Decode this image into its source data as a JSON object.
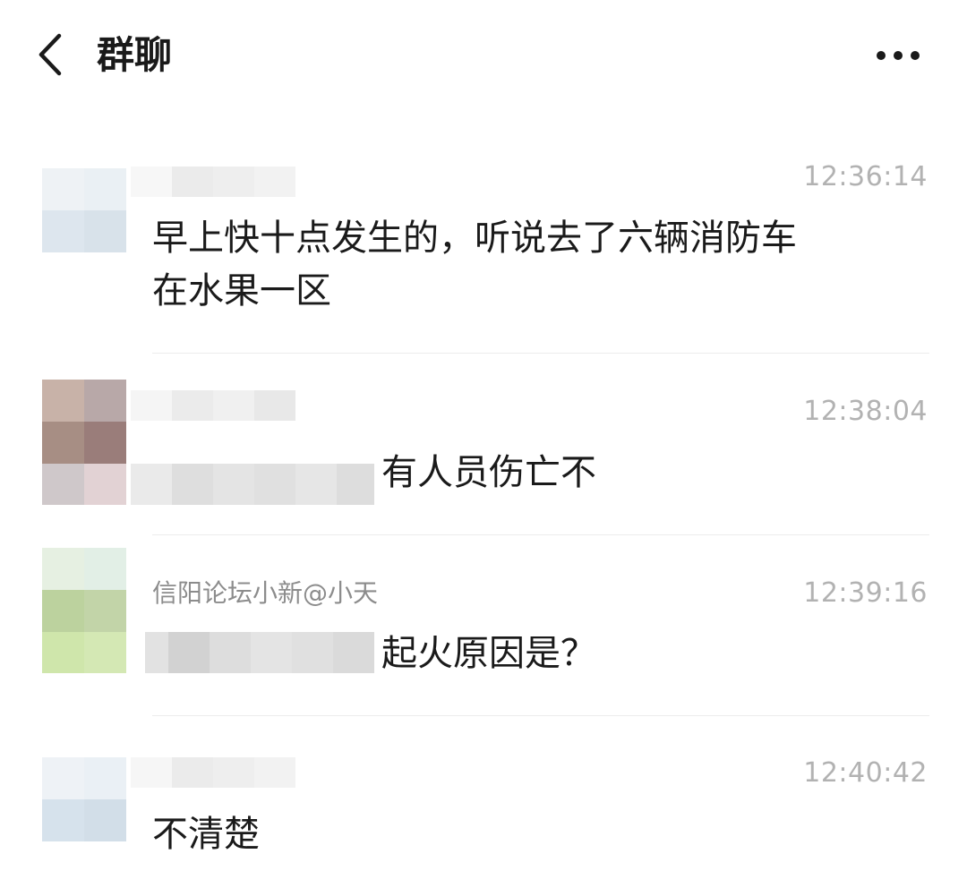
{
  "header": {
    "back_icon": "chevron-left-icon",
    "title": "群聊",
    "more_icon": "more-horizontal-icon"
  },
  "messages": [
    {
      "sender_name": "",
      "time": "12:36:14",
      "text_line1": "早上快十点发生的，听说去了六辆消防车",
      "text_line2": "在水果一区"
    },
    {
      "sender_name": "",
      "time": "12:38:04",
      "text": "有人员伤亡不"
    },
    {
      "sender_name": "信阳论坛小新@小天",
      "time": "12:39:16",
      "text": "起火原因是？"
    },
    {
      "sender_name": "",
      "time": "12:40:42",
      "text": "不清楚"
    }
  ],
  "colors": {
    "title": "#1a1a1a",
    "sender_name": "#8c8c8c",
    "timestamp": "#b2b2b2",
    "divider": "#ececec"
  }
}
